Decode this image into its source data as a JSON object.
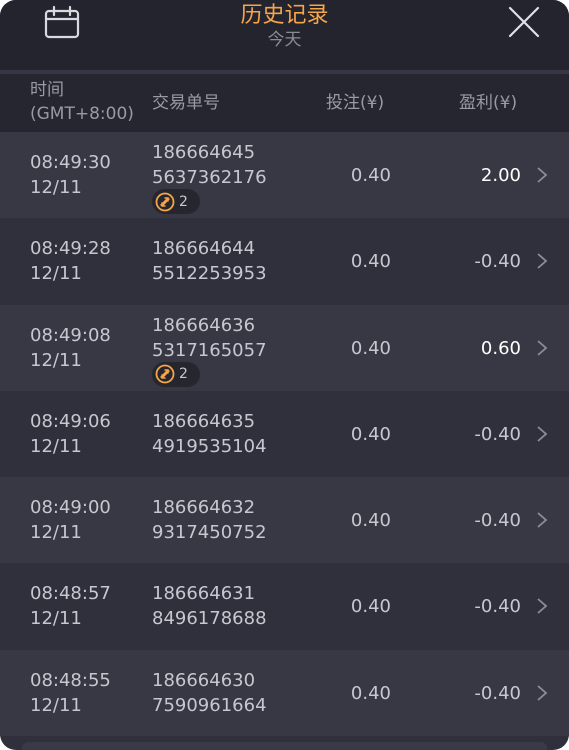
{
  "header": {
    "title": "历史记录",
    "subtitle": "今天"
  },
  "columns": {
    "time_line1": "时间",
    "time_line2": "(GMT+8:00)",
    "order": "交易单号",
    "bet": "投注(¥)",
    "profit": "盈利(¥)"
  },
  "rows": [
    {
      "time": "08:49:30",
      "date": "12/11",
      "order1": "186664645",
      "order2": "5637362176",
      "bet": "0.40",
      "profit": "2.00",
      "badge": "2"
    },
    {
      "time": "08:49:28",
      "date": "12/11",
      "order1": "186664644",
      "order2": "5512253953",
      "bet": "0.40",
      "profit": "-0.40"
    },
    {
      "time": "08:49:08",
      "date": "12/11",
      "order1": "186664636",
      "order2": "5317165057",
      "bet": "0.40",
      "profit": "0.60",
      "badge": "2"
    },
    {
      "time": "08:49:06",
      "date": "12/11",
      "order1": "186664635",
      "order2": "4919535104",
      "bet": "0.40",
      "profit": "-0.40"
    },
    {
      "time": "08:49:00",
      "date": "12/11",
      "order1": "186664632",
      "order2": "9317450752",
      "bet": "0.40",
      "profit": "-0.40"
    },
    {
      "time": "08:48:57",
      "date": "12/11",
      "order1": "186664631",
      "order2": "8496178688",
      "bet": "0.40",
      "profit": "-0.40"
    },
    {
      "time": "08:48:55",
      "date": "12/11",
      "order1": "186664630",
      "order2": "7590961664",
      "bet": "0.40",
      "profit": "-0.40"
    }
  ],
  "colors": {
    "accent": "#f5a54a",
    "win": "#ffffff",
    "loss": "#c7c7d0",
    "panel": "#30303c"
  },
  "icons": {
    "calendar": "calendar-icon",
    "close": "close-icon",
    "chevron": "chevron-right-icon",
    "badge": "free-spin-icon"
  }
}
